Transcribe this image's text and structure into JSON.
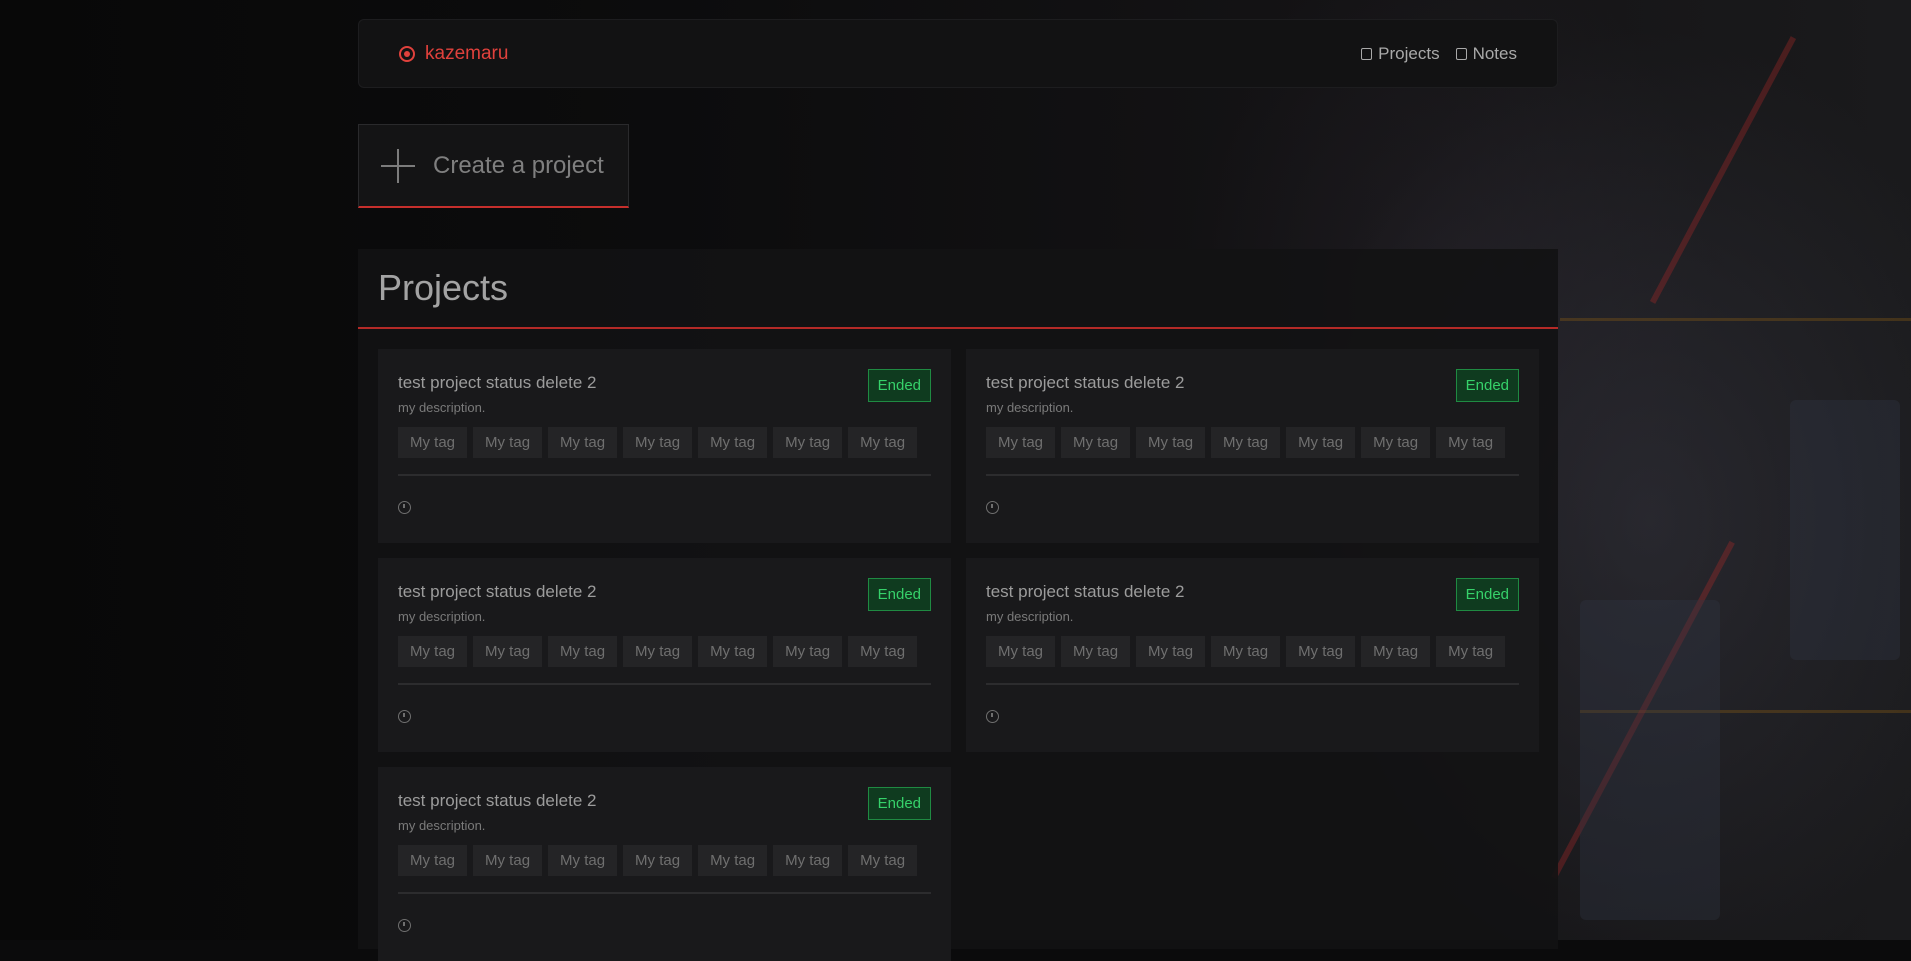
{
  "brand": {
    "name": "kazemaru",
    "icon": "brand-logo-icon",
    "color": "#e0413c"
  },
  "nav": {
    "projects_label": "Projects",
    "notes_label": "Notes"
  },
  "create": {
    "label": "Create a project"
  },
  "projects": {
    "title": "Projects",
    "items": [
      {
        "title": "test project status delete 2",
        "description": "my description.",
        "status": "Ended",
        "tags": [
          "My tag",
          "My tag",
          "My tag",
          "My tag",
          "My tag",
          "My tag",
          "My tag"
        ]
      },
      {
        "title": "test project status delete 2",
        "description": "my description.",
        "status": "Ended",
        "tags": [
          "My tag",
          "My tag",
          "My tag",
          "My tag",
          "My tag",
          "My tag",
          "My tag"
        ]
      },
      {
        "title": "test project status delete 2",
        "description": "my description.",
        "status": "Ended",
        "tags": [
          "My tag",
          "My tag",
          "My tag",
          "My tag",
          "My tag",
          "My tag",
          "My tag"
        ]
      },
      {
        "title": "test project status delete 2",
        "description": "my description.",
        "status": "Ended",
        "tags": [
          "My tag",
          "My tag",
          "My tag",
          "My tag",
          "My tag",
          "My tag",
          "My tag"
        ]
      },
      {
        "title": "test project status delete 2",
        "description": "my description.",
        "status": "Ended",
        "tags": [
          "My tag",
          "My tag",
          "My tag",
          "My tag",
          "My tag",
          "My tag",
          "My tag"
        ]
      }
    ]
  },
  "colors": {
    "accent": "#c62f2c",
    "status_ended": "#36d16a"
  }
}
